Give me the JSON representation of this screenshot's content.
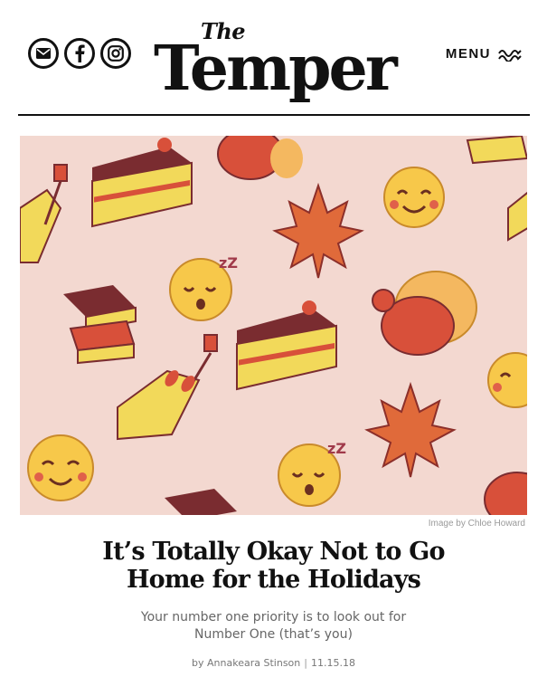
{
  "header": {
    "logo_the": "The",
    "logo_name": "Temper",
    "menu_label": "MENU",
    "social_icons": [
      "mail-icon",
      "facebook-icon",
      "instagram-icon"
    ]
  },
  "hero": {
    "image_credit": "Image by Chloe Howard",
    "background_color": "#f3d8d0",
    "illustration_items": [
      "smiley-face",
      "sleepy-face",
      "cake-slice",
      "maple-leaf",
      "turkey",
      "books",
      "hand-with-nail-polish"
    ]
  },
  "article": {
    "headline_line1": "It’s Totally Okay Not to Go",
    "headline_line2": "Home for the Holidays",
    "dek_line1": "Your number one priority is to look out for",
    "dek_line2": "Number One (that’s you)",
    "byline": "by Annakeara Stinson",
    "separator": "|",
    "date": "11.15.18"
  }
}
